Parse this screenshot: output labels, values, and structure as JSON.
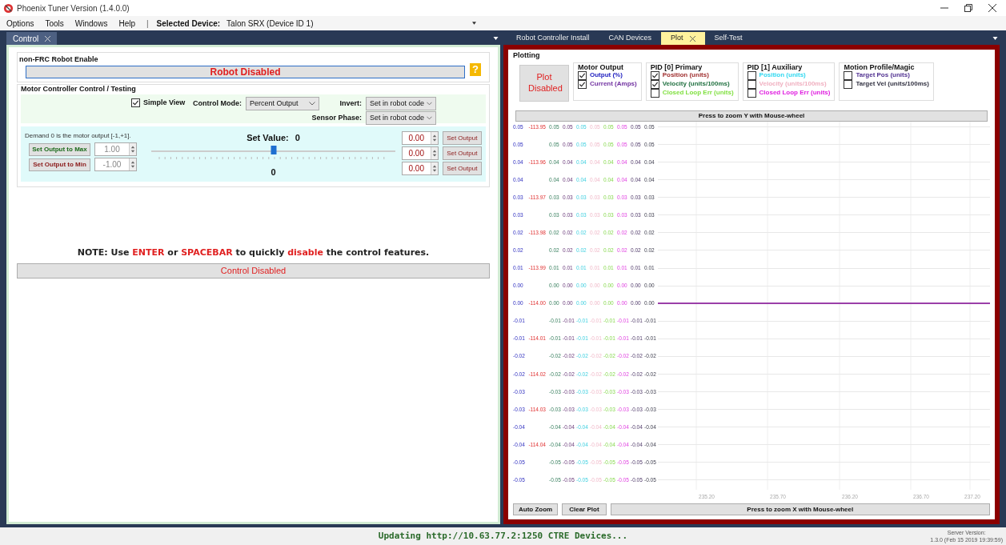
{
  "window": {
    "title": "Phoenix Tuner Version (1.4.0.0)"
  },
  "menu": [
    "Options",
    "Tools",
    "Windows",
    "Help"
  ],
  "menu_separator": "|",
  "selected_device": {
    "label": "Selected Device:",
    "value": "Talon SRX (Device ID 1)"
  },
  "left_tabs": [
    {
      "label": "Control",
      "selected": true
    }
  ],
  "robot_enable": {
    "title": "non-FRC Robot Enable",
    "button": "Robot Disabled",
    "help": "?"
  },
  "motor_control": {
    "title": "Motor Controller Control / Testing",
    "simple_view": {
      "label": "Simple View",
      "checked": true
    },
    "control_mode": {
      "label": "Control Mode:",
      "value": "Percent Output"
    },
    "invert": {
      "label": "Invert:",
      "value": "Set in robot code"
    },
    "sensor_phase": {
      "label": "Sensor Phase:",
      "value": "Set in robot code"
    },
    "demand_hint": "Demand 0 is the motor output [-1,+1].",
    "max": {
      "button": "Set Output to Max",
      "value": "1.00"
    },
    "min": {
      "button": "Set Output to Min",
      "value": "-1.00"
    },
    "set_value_label": "Set Value:",
    "set_value": "0",
    "slider": {
      "level": 0.5
    },
    "slider_reading": "0",
    "outputs": [
      {
        "value": "0.00",
        "button": "Set Output"
      },
      {
        "value": "0.00",
        "button": "Set Output"
      },
      {
        "value": "0.00",
        "button": "Set Output"
      }
    ]
  },
  "note": [
    {
      "text": "NOTE: Use ",
      "emphasis": false
    },
    {
      "text": "ENTER",
      "emphasis": true
    },
    {
      "text": " or ",
      "emphasis": false
    },
    {
      "text": "SPACEBAR",
      "emphasis": true
    },
    {
      "text": " to quickly ",
      "emphasis": false
    },
    {
      "text": "disable",
      "emphasis": true
    },
    {
      "text": " the control features.",
      "emphasis": false
    }
  ],
  "control_status": "Control Disabled",
  "right_tabs": [
    {
      "label": "Robot Controller Install",
      "selected": false
    },
    {
      "label": "CAN Devices",
      "selected": false
    },
    {
      "label": "Plot",
      "selected": true
    },
    {
      "label": "Self-Test",
      "selected": false
    }
  ],
  "plotting": {
    "title": "Plotting",
    "plot_button": "Plot Disabled",
    "groups": [
      {
        "title": "Motor Output",
        "items": [
          {
            "label": "Output (%)",
            "checked": true,
            "color": "#2020c0"
          },
          {
            "label": "Current (Amps)",
            "checked": true,
            "color": "#7030a0"
          }
        ]
      },
      {
        "title": "PID [0] Primary",
        "items": [
          {
            "label": "Position (units)",
            "checked": true,
            "color": "#a03030"
          },
          {
            "label": "Velocity (units/100ms)",
            "checked": true,
            "color": "#207040"
          },
          {
            "label": "Closed Loop Err (units)",
            "checked": false,
            "color": "#80e040"
          }
        ]
      },
      {
        "title": "PID [1] Auxiliary",
        "items": [
          {
            "label": "Position (units)",
            "checked": false,
            "color": "#30d8f0"
          },
          {
            "label": "Velocity (units/100ms)",
            "checked": false,
            "color": "#f0b0c0"
          },
          {
            "label": "Closed Loop Err (units)",
            "checked": false,
            "color": "#e020e0"
          }
        ]
      },
      {
        "title": "Motion Profile/Magic",
        "items": [
          {
            "label": "Target Pos (units)",
            "checked": false,
            "color": "#503090"
          },
          {
            "label": "Target Vel (units/100ms)",
            "checked": false,
            "color": "#303040"
          }
        ]
      }
    ],
    "zoom_y": "Press to zoom Y with Mouse-wheel",
    "axis_rows": [
      {
        "label": "0.05",
        "raw": "-113.95",
        "cells": [
          "0.05",
          "0.05",
          "0.05",
          "0.05",
          "0.05",
          "0.05",
          "0.05",
          "0.05"
        ],
        "trace": false
      },
      {
        "label": "0.05",
        "cells": [
          "0.05",
          "0.05",
          "0.05",
          "0.05",
          "0.05",
          "0.05",
          "0.05",
          "0.05"
        ],
        "trace": false
      },
      {
        "label": "0.04",
        "raw": "-113.96",
        "cells": [
          "0.04",
          "0.04",
          "0.04",
          "0.04",
          "0.04",
          "0.04",
          "0.04",
          "0.04"
        ],
        "trace": false
      },
      {
        "label": "0.04",
        "cells": [
          "0.04",
          "0.04",
          "0.04",
          "0.04",
          "0.04",
          "0.04",
          "0.04",
          "0.04"
        ],
        "trace": false
      },
      {
        "label": "0.03",
        "raw": "-113.97",
        "cells": [
          "0.03",
          "0.03",
          "0.03",
          "0.03",
          "0.03",
          "0.03",
          "0.03",
          "0.03"
        ],
        "trace": false
      },
      {
        "label": "0.03",
        "cells": [
          "0.03",
          "0.03",
          "0.03",
          "0.03",
          "0.03",
          "0.03",
          "0.03",
          "0.03"
        ],
        "trace": false
      },
      {
        "label": "0.02",
        "raw": "-113.98",
        "cells": [
          "0.02",
          "0.02",
          "0.02",
          "0.02",
          "0.02",
          "0.02",
          "0.02",
          "0.02"
        ],
        "trace": false
      },
      {
        "label": "0.02",
        "cells": [
          "0.02",
          "0.02",
          "0.02",
          "0.02",
          "0.02",
          "0.02",
          "0.02",
          "0.02"
        ],
        "trace": false
      },
      {
        "label": "0.01",
        "raw": "-113.99",
        "cells": [
          "0.01",
          "0.01",
          "0.01",
          "0.01",
          "0.01",
          "0.01",
          "0.01",
          "0.01"
        ],
        "trace": false
      },
      {
        "label": "0.00",
        "cells": [
          "0.00",
          "0.00",
          "0.00",
          "0.00",
          "0.00",
          "0.00",
          "0.00",
          "0.00"
        ],
        "trace": false
      },
      {
        "label": "0.00",
        "raw": "-114.00",
        "cells": [
          "0.00",
          "0.00",
          "0.00",
          "0.00",
          "0.00",
          "0.00",
          "0.00",
          "0.00"
        ],
        "trace": true
      },
      {
        "label": "-0.01",
        "cells": [
          "-0.01",
          "-0.01",
          "-0.01",
          "-0.01",
          "-0.01",
          "-0.01",
          "-0.01",
          "-0.01"
        ],
        "trace": false
      },
      {
        "label": "-0.01",
        "raw": "-114.01",
        "cells": [
          "-0.01",
          "-0.01",
          "-0.01",
          "-0.01",
          "-0.01",
          "-0.01",
          "-0.01",
          "-0.01"
        ],
        "trace": false
      },
      {
        "label": "-0.02",
        "cells": [
          "-0.02",
          "-0.02",
          "-0.02",
          "-0.02",
          "-0.02",
          "-0.02",
          "-0.02",
          "-0.02"
        ],
        "trace": false
      },
      {
        "label": "-0.02",
        "raw": "-114.02",
        "cells": [
          "-0.02",
          "-0.02",
          "-0.02",
          "-0.02",
          "-0.02",
          "-0.02",
          "-0.02",
          "-0.02"
        ],
        "trace": false
      },
      {
        "label": "-0.03",
        "cells": [
          "-0.03",
          "-0.03",
          "-0.03",
          "-0.03",
          "-0.03",
          "-0.03",
          "-0.03",
          "-0.03"
        ],
        "trace": false
      },
      {
        "label": "-0.03",
        "raw": "-114.03",
        "cells": [
          "-0.03",
          "-0.03",
          "-0.03",
          "-0.03",
          "-0.03",
          "-0.03",
          "-0.03",
          "-0.03"
        ],
        "trace": false
      },
      {
        "label": "-0.04",
        "cells": [
          "-0.04",
          "-0.04",
          "-0.04",
          "-0.04",
          "-0.04",
          "-0.04",
          "-0.04",
          "-0.04"
        ],
        "trace": false
      },
      {
        "label": "-0.04",
        "raw": "-114.04",
        "cells": [
          "-0.04",
          "-0.04",
          "-0.04",
          "-0.04",
          "-0.04",
          "-0.04",
          "-0.04",
          "-0.04"
        ],
        "trace": false
      },
      {
        "label": "-0.05",
        "cells": [
          "-0.05",
          "-0.05",
          "-0.05",
          "-0.05",
          "-0.05",
          "-0.05",
          "-0.05",
          "-0.05"
        ],
        "trace": false
      },
      {
        "label": "-0.05",
        "cells": [
          "-0.05",
          "-0.05",
          "-0.05",
          "-0.05",
          "-0.05",
          "-0.05",
          "-0.05",
          "-0.05"
        ],
        "trace": false
      }
    ],
    "x_ticks": [
      "235.20",
      "235.70",
      "236.20",
      "236.70",
      "237.20"
    ],
    "auto_zoom": "Auto Zoom",
    "clear_plot": "Clear Plot",
    "zoom_x": "Press to zoom X with Mouse-wheel"
  },
  "status_bar": {
    "message": "Updating http://10.63.77.2:1250 CTRE Devices...",
    "server_version": [
      "Server Version:",
      "1.3.0 (Feb 15 2019 19:39:59)"
    ]
  }
}
